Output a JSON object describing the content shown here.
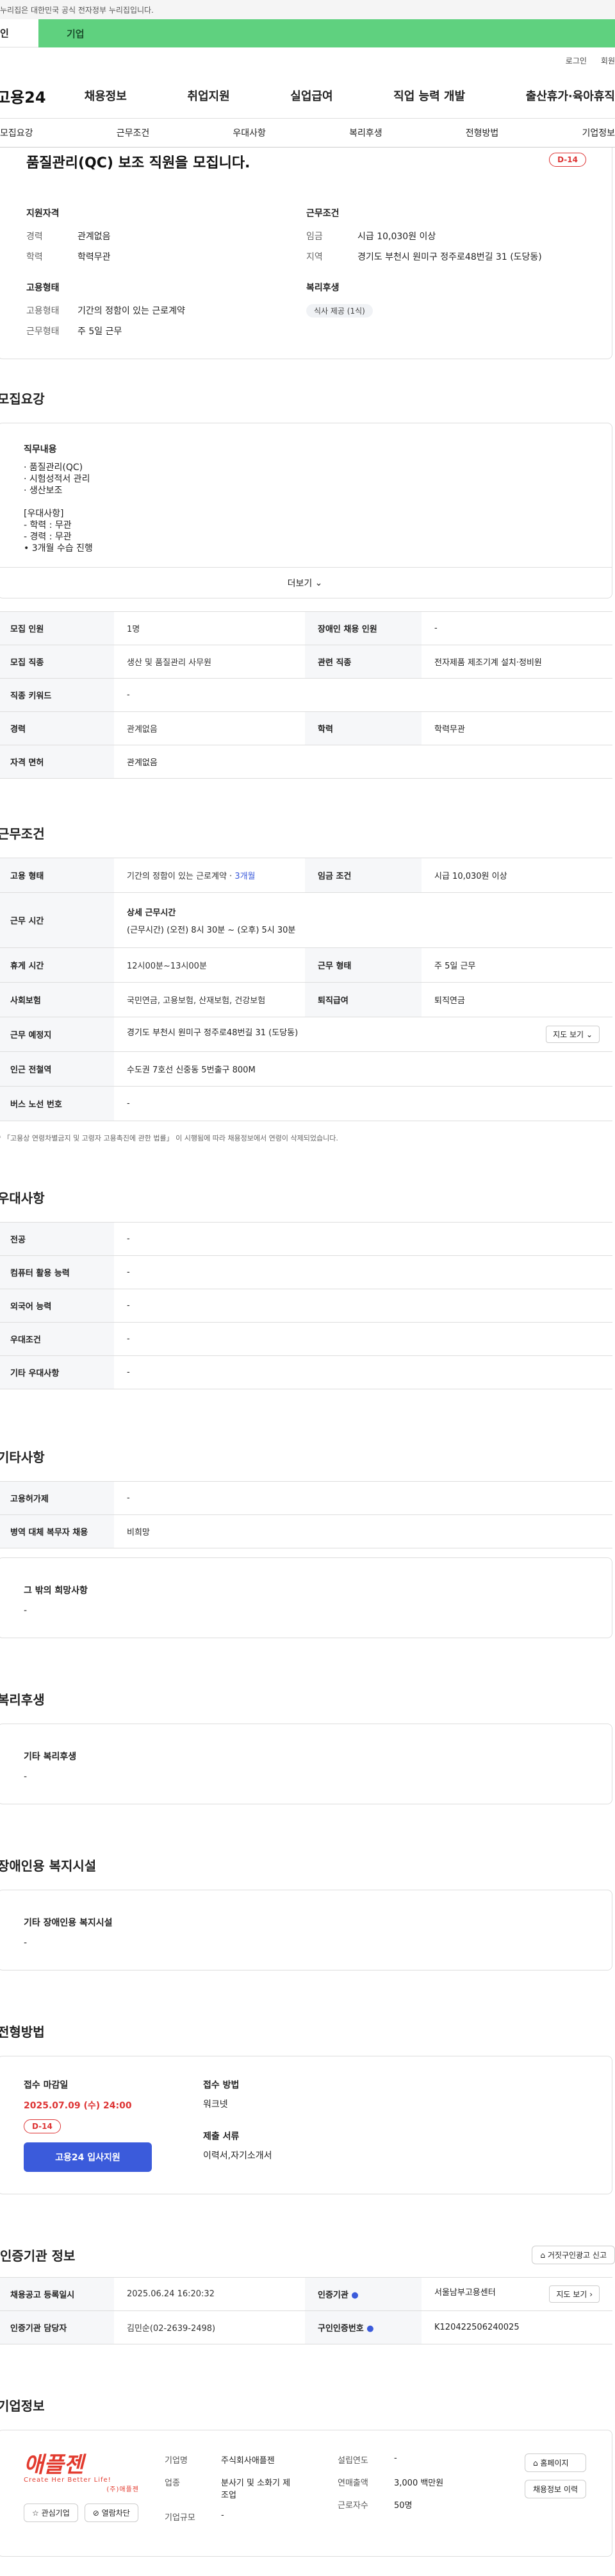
{
  "topbar": {
    "notice": "누리집은 대한민국 공식 전자정부 누리집입니다."
  },
  "usertabs": {
    "personal": "인",
    "corporate": "기업"
  },
  "gnb_top": {
    "login": "로그인",
    "signup": "회원"
  },
  "gnb": {
    "logo": "고용24",
    "menu": [
      "채용정보",
      "취업지원",
      "실업급여",
      "직업 능력 개발",
      "출산휴가·육아휴직"
    ]
  },
  "subnav": [
    "모집요강",
    "근무조건",
    "우대사항",
    "복리후생",
    "전형방법",
    "기업정보"
  ],
  "header": {
    "title": "품질관리(QC) 보조 직원을 모집니다.",
    "dday": "D-14",
    "qual_title": "지원자격",
    "qual": [
      {
        "k": "경력",
        "v": "관계없음"
      },
      {
        "k": "학력",
        "v": "학력무관"
      }
    ],
    "emp_title": "고용형태",
    "emp": [
      {
        "k": "고용형태",
        "v": "기간의 정함이 있는 근로계약"
      },
      {
        "k": "근무형태",
        "v": "주 5일 근무"
      }
    ],
    "cond_title": "근무조건",
    "cond": [
      {
        "k": "임금",
        "v": "시급 10,030원 이상"
      },
      {
        "k": "지역",
        "v": "경기도 부천시 원미구 정주로48번길 31 (도당동)"
      }
    ],
    "welfare_title": "복리후생",
    "welfare_pill": "식사 제공 (1식)"
  },
  "recruit": {
    "title": "모집요강",
    "job_label": "직무내용",
    "job_text": "· 품질관리(QC)\n· 시험성적서 관리\n· 생산보조\n\n[우대사항]\n- 학력 : 무관\n- 경력 : 무관\n• 3개월 수습 진행",
    "more": "더보기",
    "rows": [
      [
        "모집 인원",
        "1명",
        "장애인 채용 인원",
        "-"
      ],
      [
        "모집 직종",
        "생산 및 품질관리 사무원",
        "관련 직종",
        "전자제품 제조기계 설치·정비원"
      ],
      [
        "직종 키워드",
        "-"
      ],
      [
        "경력",
        "관계없음",
        "학력",
        "학력무관"
      ],
      [
        "자격 면허",
        "관계없음"
      ]
    ]
  },
  "work": {
    "title": "근무조건",
    "emp_type_label": "고용 형태",
    "emp_type": "기간의 정함이 있는 근로계약 ·",
    "emp_period": "3개월",
    "wage_label": "임금 조건",
    "wage": "시급 10,030원 이상",
    "hours_label": "근무 시간",
    "hours_sub": "상세 근무시간",
    "hours": "(근무시간) (오전) 8시 30분 ~ (오후) 5시 30분",
    "rows": [
      [
        "휴게 시간",
        "12시00분~13시00분",
        "근무 형태",
        "주 5일 근무"
      ],
      [
        "사회보험",
        "국민연금, 고용보험, 산재보험, 건강보험",
        "퇴직급여",
        "퇴직연금"
      ]
    ],
    "place_label": "근무 예정지",
    "place": "경기도 부천시 원미구 정주로48번길 31 (도당동)",
    "map_btn": "지도 보기",
    "station_label": "인근 전철역",
    "station": "수도권 7호선 신중동 5번출구 800M",
    "bus_label": "버스 노선 번호",
    "bus": "-",
    "note": "* 「고용상 연령차별금지 및 고령자 고용촉진에 관한 법률」 이 시행됨에 따라 채용정보에서 연령이 삭제되었습니다."
  },
  "pref": {
    "title": "우대사항",
    "rows": [
      [
        "전공",
        "-"
      ],
      [
        "컴퓨터 활용 능력",
        "-"
      ],
      [
        "외국어 능력",
        "-"
      ],
      [
        "우대조건",
        "-"
      ],
      [
        "기타 우대사항",
        "-"
      ]
    ]
  },
  "etc": {
    "title": "기타사항",
    "rows": [
      [
        "고용허가제",
        "-"
      ],
      [
        "병역 대체 복무자 채용",
        "비희망"
      ]
    ],
    "other_label": "그 밖의 희망사항",
    "other": "-"
  },
  "welfare": {
    "title": "복리후생",
    "label": "기타 복리후생",
    "value": "-"
  },
  "disabled": {
    "title": "장애인용 복지시설",
    "label": "기타 장애인용 복지시설",
    "value": "-"
  },
  "apply": {
    "title": "전형방법",
    "deadline_label": "접수 마감일",
    "deadline": "2025.07.09 (수) 24:00",
    "dday": "D-14",
    "button": "고용24 입사지원",
    "method_label": "접수 방법",
    "method": "워크넷",
    "docs_label": "제출 서류",
    "docs": "이력서,자기소개서"
  },
  "agency": {
    "title": "인증기관 정보",
    "report_btn": "거짓구인광고 신고",
    "rows": [
      [
        "채용공고 등록일시",
        "2025.06.24 16:20:32",
        "인증기관",
        "서울남부고용센터"
      ],
      [
        "인증기관 담당자",
        "김민순(02-2639-2498)",
        "구인인증번호",
        "K120422506240025"
      ]
    ],
    "map_btn": "지도 보기"
  },
  "company": {
    "title": "기업정보",
    "logo_text": "애플젠",
    "logo_sub": "Create Her Better Life!",
    "logo_kr": "(주)애플젠",
    "follow_btn": "관심기업",
    "block_btn": "열람차단",
    "rows1": [
      [
        "기업명",
        "주식회사애플젠"
      ],
      [
        "업종",
        "분사기 및 소화기 제조업"
      ],
      [
        "기업규모",
        "-"
      ]
    ],
    "rows2": [
      [
        "설립연도",
        "-"
      ],
      [
        "연매출액",
        "3,000 백만원"
      ],
      [
        "근로자수",
        "50명"
      ]
    ],
    "home_btn": "홈페이지",
    "history_btn": "채용정보 이력"
  }
}
